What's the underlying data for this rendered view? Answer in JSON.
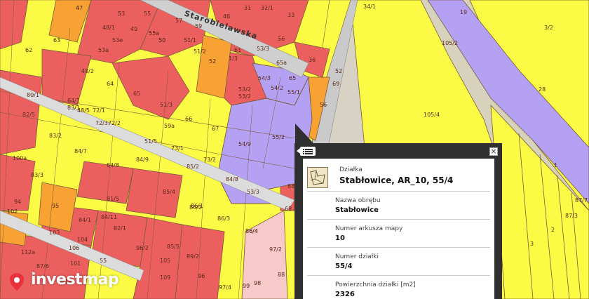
{
  "map": {
    "street_name": "Starobielawska",
    "colors": {
      "red": "#ec5f5f",
      "yellow": "#fbfb46",
      "orange": "#f7a232",
      "purple": "#b5a1f3",
      "pink": "#f7c9c9",
      "beige": "#ece7c6",
      "grey": "#cfcfcf",
      "road": "#c9c9c9",
      "outline": "#7a5a3a"
    },
    "plot_labels": [
      "47",
      "53",
      "55",
      "46",
      "31",
      "32/1",
      "33",
      "34/1",
      "48/1",
      "49",
      "55a",
      "57",
      "59",
      "50",
      "56",
      "62",
      "63",
      "53a",
      "53e",
      "50",
      "51/1",
      "48/2",
      "51/2",
      "52",
      "61",
      "1/3",
      "53/3",
      "53/2",
      "54/3",
      "65a",
      "36",
      "52",
      "105/2",
      "3/2",
      "19",
      "64",
      "65",
      "64/1",
      "54/2",
      "53/2",
      "65",
      "55/1",
      "69",
      "28",
      "82/5",
      "80/1",
      "48/5",
      "72/1",
      "72/3",
      "72/2",
      "51/3",
      "66",
      "56",
      "105/4",
      "83/2",
      "83/1",
      "59a",
      "67",
      "84/7",
      "84/9",
      "84/8",
      "51/5",
      "73/1",
      "73/2",
      "54/9",
      "55/2",
      "100a",
      "83/3",
      "85/2",
      "85/4",
      "86/1",
      "84/8",
      "86/4",
      "53/3",
      "88",
      "1",
      "94",
      "95",
      "81/5",
      "84/1",
      "84/11",
      "86/2",
      "86/3",
      "86/4",
      "68",
      "102",
      "103",
      "104",
      "106",
      "82/1",
      "96/2",
      "85/5",
      "89/2",
      "97/2",
      "112a",
      "87/6",
      "101",
      "101a",
      "55",
      "105",
      "109",
      "96",
      "97/4",
      "99",
      "98",
      "88",
      "87/7",
      "87/3",
      "2",
      "3",
      "4",
      "5"
    ]
  },
  "popup": {
    "menu_icon": "list-menu-icon",
    "close_label": "×",
    "parcel_kind": "Działka",
    "parcel_title": "Stabłowice, AR_10, 55/4",
    "attributes": [
      {
        "label": "Nazwa obrębu",
        "value": "Stabłowice"
      },
      {
        "label": "Numer arkusza mapy",
        "value": "10"
      },
      {
        "label": "Numer działki",
        "value": "55/4"
      },
      {
        "label": "Powierzchnia działki [m2]",
        "value": "2326"
      }
    ]
  },
  "logo": {
    "text": "investmap",
    "accent": "#e8323c"
  }
}
